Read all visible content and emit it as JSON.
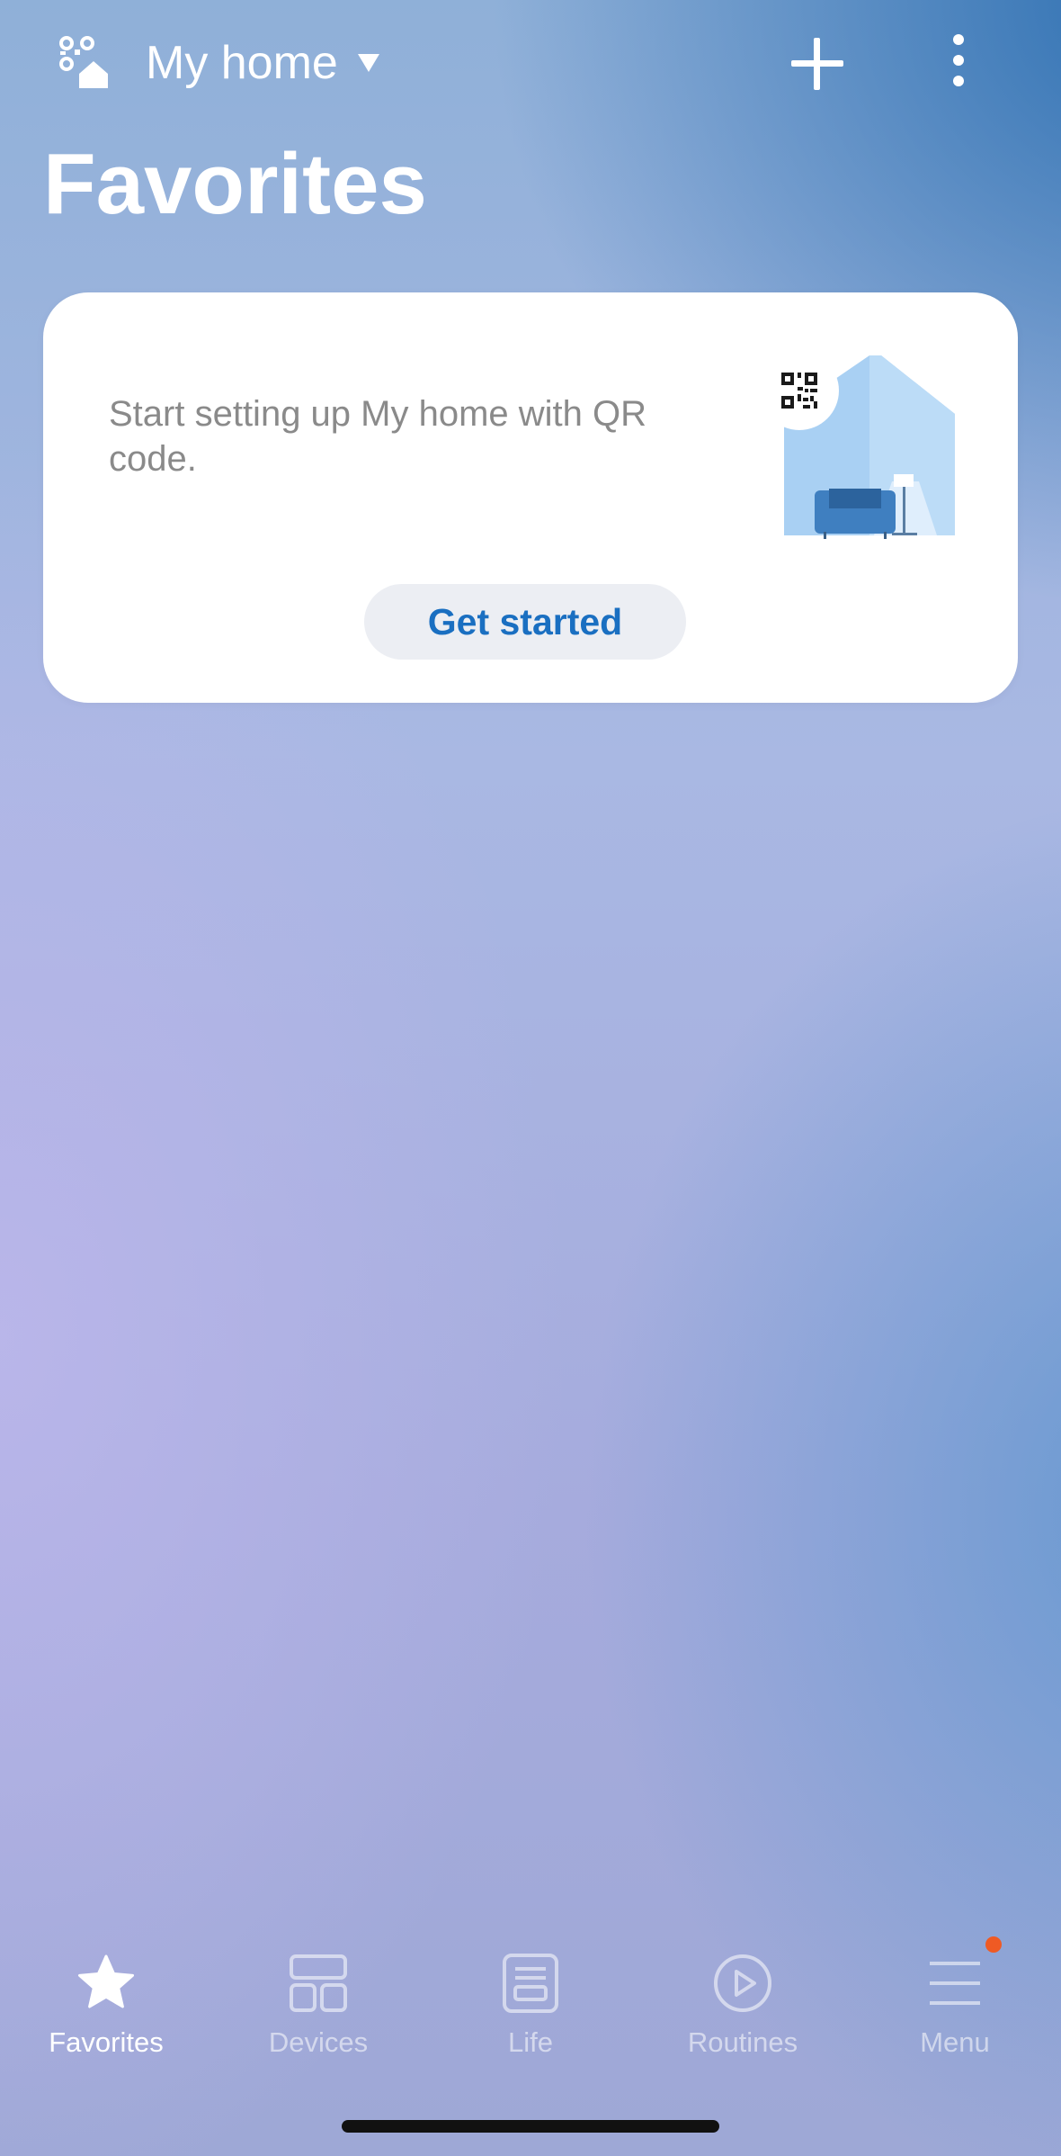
{
  "header": {
    "home_switch_icon": "qr-home-icon",
    "home_name": "My home",
    "add_icon": "plus-icon",
    "more_icon": "more-vertical-icon"
  },
  "page": {
    "title": "Favorites"
  },
  "setup_card": {
    "message": "Start setting up My home with QR code.",
    "illustration_icon": "house-with-sofa-and-qr-illustration",
    "button_label": "Get started",
    "button_text_color": "#1a6fc1"
  },
  "bottom_nav": {
    "items": [
      {
        "label": "Favorites",
        "icon": "star-icon",
        "active": true
      },
      {
        "label": "Devices",
        "icon": "devices-grid-icon",
        "active": false
      },
      {
        "label": "Life",
        "icon": "life-list-icon",
        "active": false
      },
      {
        "label": "Routines",
        "icon": "play-circle-icon",
        "active": false
      },
      {
        "label": "Menu",
        "icon": "hamburger-menu-icon",
        "active": false
      }
    ],
    "menu_notification_color": "#ef5a24"
  }
}
